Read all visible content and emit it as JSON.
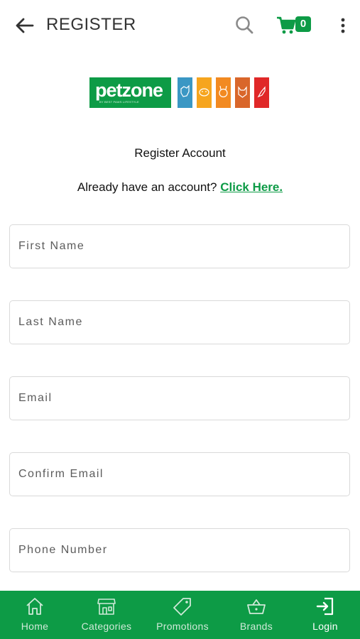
{
  "appbar": {
    "title": "REGISTER",
    "cart_count": "0"
  },
  "logo": {
    "brand": "petzone",
    "tagline": "BY BEST PAWS LIFESTYLE"
  },
  "content": {
    "heading": "Register Account",
    "have_account": "Already have an account?",
    "click_here": "Click Here."
  },
  "form": {
    "first_name": "First Name",
    "last_name": "Last Name",
    "email": "Email",
    "confirm_email": "Confirm Email",
    "phone": "Phone Number"
  },
  "nav": [
    {
      "label": "Home",
      "icon": "home-icon"
    },
    {
      "label": "Categories",
      "icon": "store-icon"
    },
    {
      "label": "Promotions",
      "icon": "tag-icon"
    },
    {
      "label": "Brands",
      "icon": "basket-icon"
    },
    {
      "label": "Login",
      "icon": "login-icon"
    }
  ],
  "colors": {
    "brand_green": "#0d9b46",
    "tile_blue": "#3a97c4",
    "tile_yellow": "#f6a51e",
    "tile_orange": "#f28a21",
    "tile_dark_orange": "#d9662a",
    "tile_red": "#e02828"
  }
}
